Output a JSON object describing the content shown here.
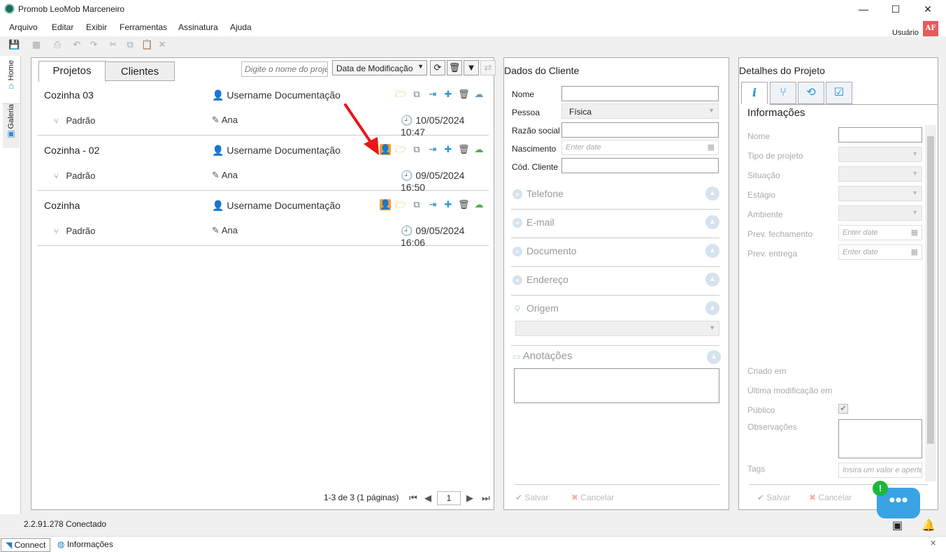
{
  "window": {
    "title": "Promob LeoMob Marceneiro",
    "minimize": "—",
    "maximize": "☐",
    "close": "✕"
  },
  "menu": [
    "Arquivo",
    "Editar",
    "Exibir",
    "Ferramentas",
    "Assinatura",
    "Ajuda"
  ],
  "user": {
    "label": "Usuário",
    "initials": "AF"
  },
  "vtabs": {
    "home": "Home",
    "galeria": "Galeria"
  },
  "projects": {
    "tabs": {
      "projetos": "Projetos",
      "clientes": "Clientes"
    },
    "search_placeholder": "Digite o nome do projeto",
    "sort": "Data de Modificação",
    "rows": [
      {
        "name": "Cozinha 03",
        "owner": "Username Documentação",
        "variant": "Padrão",
        "designer": "Ana",
        "date": "10/05/2024 10:47",
        "has_client_icon": false
      },
      {
        "name": "Cozinha - 02",
        "owner": "Username Documentação",
        "variant": "Padrão",
        "designer": "Ana",
        "date": "09/05/2024 16:50",
        "has_client_icon": true
      },
      {
        "name": "Cozinha",
        "owner": "Username Documentação",
        "variant": "Padrão",
        "designer": "Ana",
        "date": "09/05/2024 16:06",
        "has_client_icon": true
      }
    ],
    "pager": {
      "summary": "1-3 de 3 (1 páginas)",
      "page": "1"
    }
  },
  "client": {
    "title": "Dados do Cliente",
    "fields": {
      "nome": "Nome",
      "pessoa": "Pessoa",
      "pessoa_value": "Física",
      "razao": "Razão social",
      "nascimento": "Nascimento",
      "nascimento_placeholder": "Enter date",
      "cod": "Cód. Cliente"
    },
    "sections": [
      "Telefone",
      "E-mail",
      "Documento",
      "Endereço",
      "Origem"
    ],
    "anotacoes": "Anotações",
    "save": "Salvar",
    "cancel": "Cancelar"
  },
  "details": {
    "title": "Detalhes do Projeto",
    "heading": "Informações",
    "fields": [
      "Nome",
      "Tipo de projeto",
      "Situação",
      "Estágio",
      "Ambiente",
      "Prev. fechamento",
      "Prev. entrega"
    ],
    "date_placeholder": "Enter date",
    "criado": "Criado em",
    "ultima": "Última modificação em",
    "publico": "Público",
    "observacoes": "Observações",
    "tags": "Tags",
    "tags_placeholder": "Insira um valor e aperte Enter",
    "save": "Salvar",
    "cancel": "Cancelar"
  },
  "status": {
    "text": "2.2.91.278  Conectado"
  },
  "bottom": {
    "connect": "Connect",
    "info": "Informações"
  },
  "chat": {
    "badge": "!",
    "dots": "•••"
  }
}
